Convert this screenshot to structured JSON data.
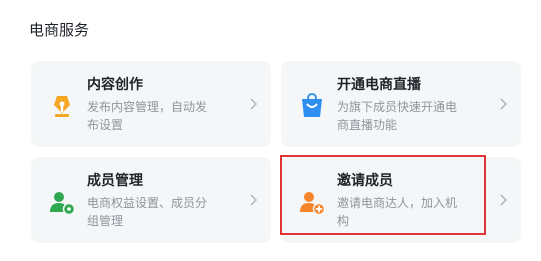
{
  "section": {
    "title": "电商服务"
  },
  "cards": [
    {
      "title": "内容创作",
      "desc": "发布内容管理，自动发布设置",
      "icon": "pen-nib-icon",
      "color": "#f5a623"
    },
    {
      "title": "开通电商直播",
      "desc": "为旗下成员快速开通电商直播功能",
      "icon": "shopping-bag-icon",
      "color": "#2e8ff0"
    },
    {
      "title": "成员管理",
      "desc": "电商权益设置、成员分组管理",
      "icon": "user-settings-icon",
      "color": "#2fa84f"
    },
    {
      "title": "邀请成员",
      "desc": "邀请电商达人，加入机构",
      "icon": "user-add-icon",
      "color": "#f5842b"
    }
  ],
  "highlight_color": "#e03535"
}
